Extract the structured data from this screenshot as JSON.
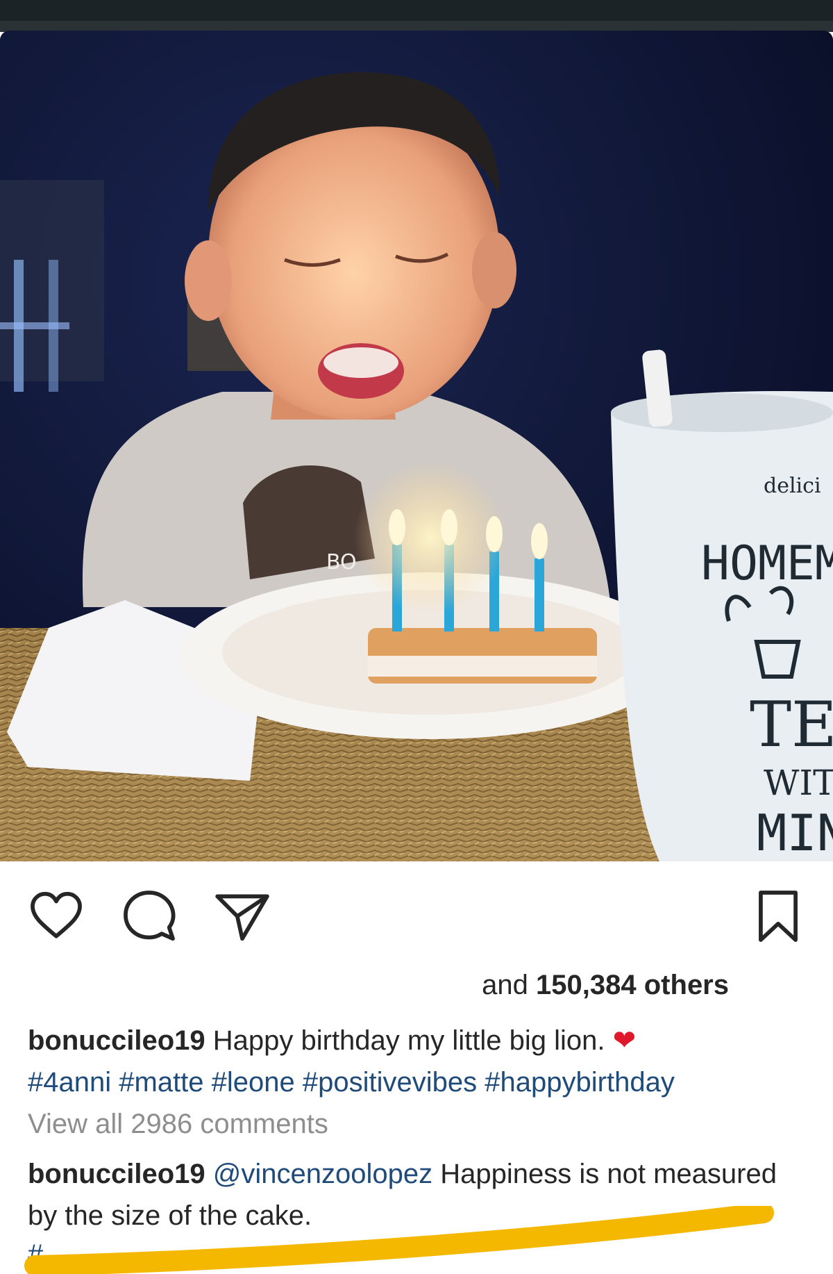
{
  "photo": {
    "mug_text": {
      "line1": "delici",
      "line2": "HOMEM",
      "line3": "TE",
      "line4": "WIT",
      "line5": "MIN"
    },
    "shirt_text": "BO"
  },
  "actions": {
    "like_icon": "heart-outline-icon",
    "comment_icon": "speech-bubble-icon",
    "share_icon": "paper-plane-icon",
    "save_icon": "bookmark-icon"
  },
  "likes": {
    "prefix": "and",
    "count": "150,384 others"
  },
  "caption": {
    "username": "bonuccileo19",
    "text": "Happy birthday my little big lion.",
    "emoji": "❤",
    "hashtags": [
      "#4anni",
      "#matte",
      "#leone",
      "#positivevibes",
      "#happybirthday"
    ]
  },
  "view_all_comments": "View all 2986 comments",
  "comment": {
    "username": "bonuccileo19",
    "mention": "@vincenzoolopez",
    "text": "Happiness is not measured by the size of the cake."
  },
  "colors": {
    "link": "#1e4b7a",
    "muted": "#8e8e8e",
    "highlight": "#f5b800",
    "heart": "#e0182b"
  }
}
